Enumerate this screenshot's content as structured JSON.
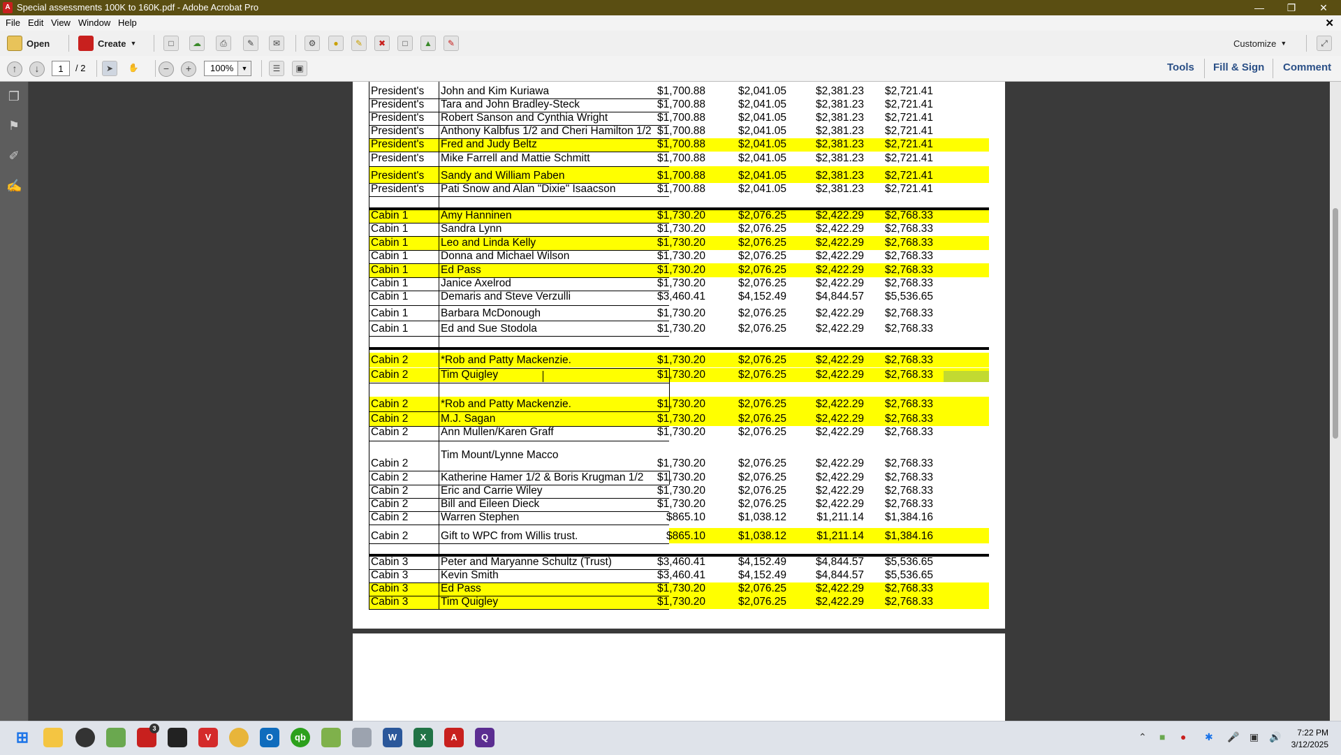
{
  "window": {
    "title": "Special assessments 100K to 160K.pdf - Adobe Acrobat Pro",
    "app_icon_label": "A"
  },
  "menu": [
    "File",
    "Edit",
    "View",
    "Window",
    "Help"
  ],
  "toolbar": {
    "open_label": "Open",
    "create_label": "Create",
    "customize_label": "Customize"
  },
  "nav": {
    "page_current": "1",
    "page_total": "/ 2",
    "zoom": "100%"
  },
  "panes": {
    "tools": "Tools",
    "fill_sign": "Fill & Sign",
    "comment": "Comment"
  },
  "table_rows": [
    {
      "cat": "President's",
      "name": "John and Kim Kuriawa",
      "v1": "$1,700.88",
      "v2": "$2,041.05",
      "v3": "$2,381.23",
      "v4": "$2,721.41",
      "hl": false
    },
    {
      "cat": "President's",
      "name": "Tara and John Bradley-Steck",
      "v1": "$1,700.88",
      "v2": "$2,041.05",
      "v3": "$2,381.23",
      "v4": "$2,721.41",
      "hl": false
    },
    {
      "cat": "President's",
      "name": "Robert Sanson and Cynthia Wright",
      "v1": "$1,700.88",
      "v2": "$2,041.05",
      "v3": "$2,381.23",
      "v4": "$2,721.41",
      "hl": false
    },
    {
      "cat": "President's",
      "name": "Anthony Kalbfus  1/2 and Cheri Hamilton 1/2",
      "v1": "$1,700.88",
      "v2": "$2,041.05",
      "v3": "$2,381.23",
      "v4": "$2,721.41",
      "hl": false
    },
    {
      "cat": "President's",
      "name": "Fred and Judy Beltz",
      "v1": "$1,700.88",
      "v2": "$2,041.05",
      "v3": "$2,381.23",
      "v4": "$2,721.41",
      "hl": true
    },
    {
      "cat": "President's",
      "name": "Mike Farrell and Mattie Schmitt",
      "v1": "$1,700.88",
      "v2": "$2,041.05",
      "v3": "$2,381.23",
      "v4": "$2,721.41",
      "hl": false
    },
    {
      "cat": "President's",
      "name": "Sandy and William Paben",
      "v1": "$1,700.88",
      "v2": "$2,041.05",
      "v3": "$2,381.23",
      "v4": "$2,721.41",
      "hl": true
    },
    {
      "cat": "President's",
      "name": "Pati Snow and Alan \"Dixie\" Isaacson",
      "v1": "$1,700.88",
      "v2": "$2,041.05",
      "v3": "$2,381.23",
      "v4": "$2,721.41",
      "hl": false
    },
    {
      "cat": "Cabin 1",
      "name": "Amy Hanninen",
      "v1": "$1,730.20",
      "v2": "$2,076.25",
      "v3": "$2,422.29",
      "v4": "$2,768.33",
      "hl": true
    },
    {
      "cat": "Cabin 1",
      "name": "Sandra Lynn",
      "v1": "$1,730.20",
      "v2": "$2,076.25",
      "v3": "$2,422.29",
      "v4": "$2,768.33",
      "hl": false
    },
    {
      "cat": "Cabin 1",
      "name": "Leo and Linda Kelly",
      "v1": "$1,730.20",
      "v2": "$2,076.25",
      "v3": "$2,422.29",
      "v4": "$2,768.33",
      "hl": true
    },
    {
      "cat": "Cabin 1",
      "name": "Donna and Michael Wilson",
      "v1": "$1,730.20",
      "v2": "$2,076.25",
      "v3": "$2,422.29",
      "v4": "$2,768.33",
      "hl": false
    },
    {
      "cat": "Cabin 1",
      "name": "Ed Pass",
      "v1": "$1,730.20",
      "v2": "$2,076.25",
      "v3": "$2,422.29",
      "v4": "$2,768.33",
      "hl": true
    },
    {
      "cat": "Cabin 1",
      "name": "Janice Axelrod",
      "v1": "$1,730.20",
      "v2": "$2,076.25",
      "v3": "$2,422.29",
      "v4": "$2,768.33",
      "hl": false
    },
    {
      "cat": "Cabin 1",
      "name": "Demaris and Steve Verzulli",
      "v1": "$3,460.41",
      "v2": "$4,152.49",
      "v3": "$4,844.57",
      "v4": "$5,536.65",
      "hl": false
    },
    {
      "cat": "Cabin 1",
      "name": "Barbara McDonough",
      "v1": "$1,730.20",
      "v2": "$2,076.25",
      "v3": "$2,422.29",
      "v4": "$2,768.33",
      "hl": false
    },
    {
      "cat": "Cabin 1",
      "name": "Ed and Sue Stodola",
      "v1": "$1,730.20",
      "v2": "$2,076.25",
      "v3": "$2,422.29",
      "v4": "$2,768.33",
      "hl": false
    },
    {
      "cat": "Cabin 2",
      "name": "*Rob and Patty Mackenzie.",
      "v1": "$1,730.20",
      "v2": "$2,076.25",
      "v3": "$2,422.29",
      "v4": "$2,768.33",
      "hl": true
    },
    {
      "cat": "Cabin 2",
      "name": "Tim Quigley",
      "v1": "$1,730.20",
      "v2": "$2,076.25",
      "v3": "$2,422.29",
      "v4": "$2,768.33",
      "hl": true
    },
    {
      "cat": "Cabin 2",
      "name": "*Rob and Patty Mackenzie.",
      "v1": "$1,730.20",
      "v2": "$2,076.25",
      "v3": "$2,422.29",
      "v4": "$2,768.33",
      "hl": true
    },
    {
      "cat": "Cabin 2",
      "name": "M.J. Sagan",
      "v1": "$1,730.20",
      "v2": "$2,076.25",
      "v3": "$2,422.29",
      "v4": "$2,768.33",
      "hl": true
    },
    {
      "cat": "Cabin 2",
      "name": "Ann Mullen/Karen Graff",
      "v1": "$1,730.20",
      "v2": "$2,076.25",
      "v3": "$2,422.29",
      "v4": "$2,768.33",
      "hl": false
    },
    {
      "cat": "Cabin 2",
      "name": "Tim Mount/Lynne Macco",
      "v1": "$1,730.20",
      "v2": "$2,076.25",
      "v3": "$2,422.29",
      "v4": "$2,768.33",
      "hl": false
    },
    {
      "cat": "Cabin 2",
      "name": "Katherine Hamer 1/2 & Boris Krugman 1/2",
      "v1": "$1,730.20",
      "v2": "$2,076.25",
      "v3": "$2,422.29",
      "v4": "$2,768.33",
      "hl": false
    },
    {
      "cat": "Cabin 2",
      "name": "Eric and Carrie Wiley",
      "v1": "$1,730.20",
      "v2": "$2,076.25",
      "v3": "$2,422.29",
      "v4": "$2,768.33",
      "hl": false
    },
    {
      "cat": "Cabin 2",
      "name": "Bill and Eileen Dieck",
      "v1": "$1,730.20",
      "v2": "$2,076.25",
      "v3": "$2,422.29",
      "v4": "$2,768.33",
      "hl": false
    },
    {
      "cat": "Cabin 2",
      "name": "Warren Stephen",
      "v1": "$865.10",
      "v2": "$1,038.12",
      "v3": "$1,211.14",
      "v4": "$1,384.16",
      "hl": false
    },
    {
      "cat": "Cabin 2",
      "name": "Gift to WPC from Willis trust.",
      "v1": "$865.10",
      "v2": "$1,038.12",
      "v3": "$1,211.14",
      "v4": "$1,384.16",
      "hl": "values"
    },
    {
      "cat": "Cabin 3",
      "name": "Peter and Maryanne Schultz (Trust)",
      "v1": "$3,460.41",
      "v2": "$4,152.49",
      "v3": "$4,844.57",
      "v4": "$5,536.65",
      "hl": false
    },
    {
      "cat": "Cabin 3",
      "name": "Kevin Smith",
      "v1": "$3,460.41",
      "v2": "$4,152.49",
      "v3": "$4,844.57",
      "v4": "$5,536.65",
      "hl": false
    },
    {
      "cat": "Cabin 3",
      "name": "Ed Pass",
      "v1": "$1,730.20",
      "v2": "$2,076.25",
      "v3": "$2,422.29",
      "v4": "$2,768.33",
      "hl": true
    },
    {
      "cat": "Cabin 3",
      "name": "Tim Quigley",
      "v1": "$1,730.20",
      "v2": "$2,076.25",
      "v3": "$2,422.29",
      "v4": "$2,768.33",
      "hl": true
    }
  ],
  "taskbar": {
    "time": "7:22 PM",
    "date": "3/12/2025",
    "badge": "3"
  },
  "colors": {
    "highlight": "#ffff00",
    "titlebar": "#5a4e12",
    "pane_link": "#2a4f86"
  }
}
